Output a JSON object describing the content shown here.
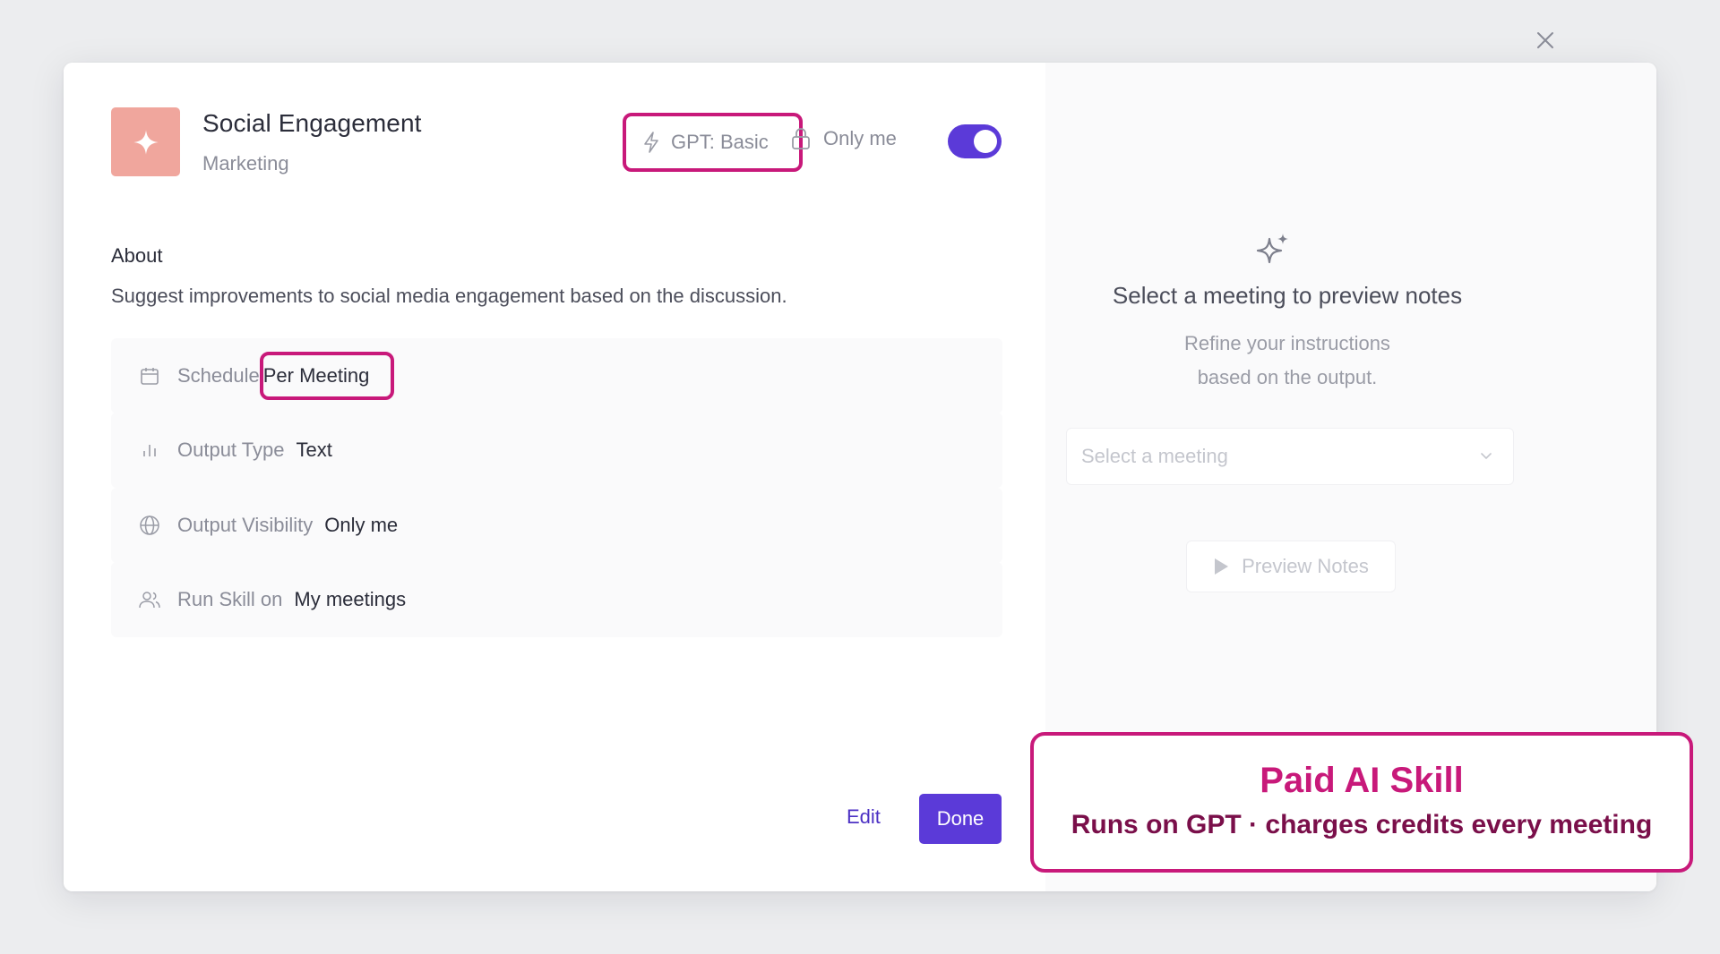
{
  "header": {
    "title": "Social Engagement",
    "category": "Marketing",
    "model_chip": "GPT: Basic",
    "visibility_chip": "Only me",
    "enabled": true
  },
  "about": {
    "heading": "About",
    "description": "Suggest improvements to social media engagement based on the discussion."
  },
  "properties": [
    {
      "icon": "calendar-icon",
      "label": "Schedule",
      "value": "Per Meeting"
    },
    {
      "icon": "bar-chart-icon",
      "label": "Output Type",
      "value": "Text"
    },
    {
      "icon": "globe-icon",
      "label": "Output Visibility",
      "value": "Only me"
    },
    {
      "icon": "users-icon",
      "label": "Run Skill on",
      "value": "My meetings"
    }
  ],
  "footer": {
    "edit_label": "Edit",
    "done_label": "Done"
  },
  "preview": {
    "title": "Select a meeting to preview notes",
    "subtitle": "Refine your instructions based on the output.",
    "select_placeholder": "Select a meeting",
    "button_label": "Preview Notes"
  },
  "callout": {
    "title": "Paid AI Skill",
    "subtitle": "Runs on GPT · charges credits every meeting"
  },
  "colors": {
    "accent": "#5b3ad8",
    "highlight": "#c8197a",
    "skill_icon_bg": "#f0a69d"
  }
}
